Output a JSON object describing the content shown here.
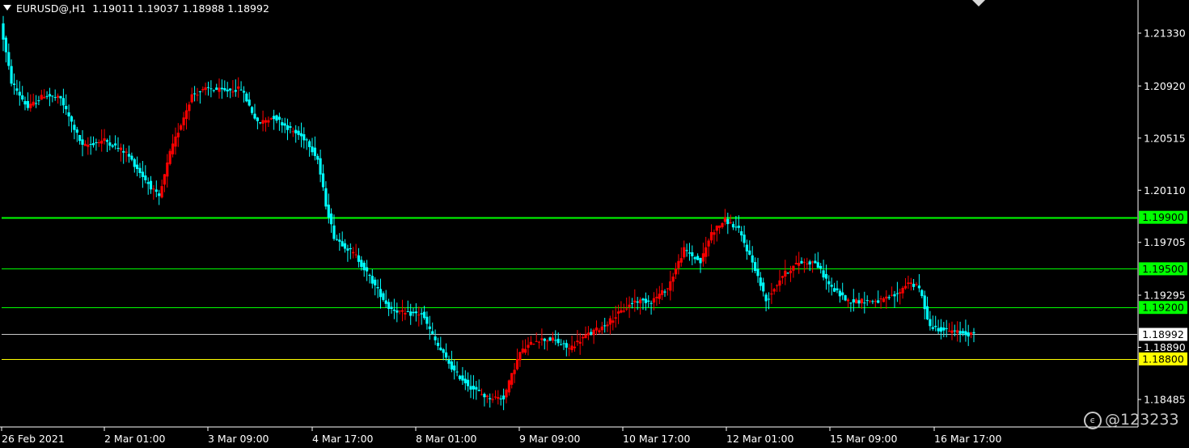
{
  "header": {
    "symbol": "EURUSD@,H1",
    "ohlc": "1.19011 1.19037 1.18988 1.18992"
  },
  "watermark": {
    "text": "@123233"
  },
  "colors": {
    "background": "#000000",
    "bull": "#ff0000",
    "bear": "#00ffff",
    "support_green": "#00ff00",
    "support_yellow": "#ffff00",
    "axis": "#ffffff"
  },
  "chart_data": {
    "type": "candlestick",
    "title": "",
    "ylim": [
      1.1828,
      1.2155
    ],
    "y_ticks": [
      "1.21330",
      "1.20920",
      "1.20515",
      "1.20110",
      "1.19705",
      "1.19295",
      "1.18890",
      "1.18485"
    ],
    "x_ticks": [
      "26 Feb 2021",
      "2 Mar 01:00",
      "3 Mar 09:00",
      "4 Mar 17:00",
      "8 Mar 01:00",
      "9 Mar 09:00",
      "10 Mar 17:00",
      "12 Mar 01:00",
      "15 Mar 09:00",
      "16 Mar 17:00"
    ],
    "current_price": {
      "value": 1.18992,
      "label": "1.18992"
    },
    "horizontal_lines": [
      {
        "value": 1.199,
        "label": "1.19900",
        "color": "#00ff00"
      },
      {
        "value": 1.195,
        "label": "1.19500",
        "color": "#00ff00"
      },
      {
        "value": 1.192,
        "label": "1.19200",
        "color": "#00ff00"
      },
      {
        "value": 1.188,
        "label": "1.18800",
        "color": "#ffff00"
      }
    ],
    "path_points": [
      [
        0,
        1.214
      ],
      [
        4,
        1.2095
      ],
      [
        10,
        1.2075
      ],
      [
        16,
        1.2085
      ],
      [
        22,
        1.2082
      ],
      [
        30,
        1.2045
      ],
      [
        38,
        1.205
      ],
      [
        46,
        1.204
      ],
      [
        52,
        1.2022
      ],
      [
        58,
        1.2005
      ],
      [
        62,
        1.204
      ],
      [
        70,
        1.2085
      ],
      [
        76,
        1.209
      ],
      [
        82,
        1.2088
      ],
      [
        88,
        1.209
      ],
      [
        94,
        1.2063
      ],
      [
        100,
        1.2068
      ],
      [
        106,
        1.2058
      ],
      [
        112,
        1.205
      ],
      [
        116,
        1.2035
      ],
      [
        119,
        1.2
      ],
      [
        122,
        1.1975
      ],
      [
        130,
        1.196
      ],
      [
        136,
        1.194
      ],
      [
        142,
        1.192
      ],
      [
        148,
        1.1915
      ],
      [
        154,
        1.1915
      ],
      [
        160,
        1.189
      ],
      [
        166,
        1.187
      ],
      [
        172,
        1.1858
      ],
      [
        178,
        1.185
      ],
      [
        184,
        1.185
      ],
      [
        190,
        1.1885
      ],
      [
        196,
        1.1895
      ],
      [
        202,
        1.1895
      ],
      [
        208,
        1.1888
      ],
      [
        214,
        1.1898
      ],
      [
        220,
        1.1905
      ],
      [
        226,
        1.1915
      ],
      [
        232,
        1.1925
      ],
      [
        238,
        1.1925
      ],
      [
        244,
        1.1935
      ],
      [
        250,
        1.1965
      ],
      [
        256,
        1.1955
      ],
      [
        260,
        1.1978
      ],
      [
        265,
        1.1988
      ],
      [
        270,
        1.198
      ],
      [
        276,
        1.195
      ],
      [
        280,
        1.1925
      ],
      [
        286,
        1.1945
      ],
      [
        292,
        1.1955
      ],
      [
        298,
        1.1955
      ],
      [
        304,
        1.1935
      ],
      [
        310,
        1.1925
      ],
      [
        316,
        1.1925
      ],
      [
        322,
        1.1925
      ],
      [
        328,
        1.193
      ],
      [
        332,
        1.194
      ],
      [
        336,
        1.1935
      ],
      [
        340,
        1.1905
      ],
      [
        346,
        1.1902
      ],
      [
        352,
        1.19
      ],
      [
        355,
        1.1899
      ]
    ]
  }
}
